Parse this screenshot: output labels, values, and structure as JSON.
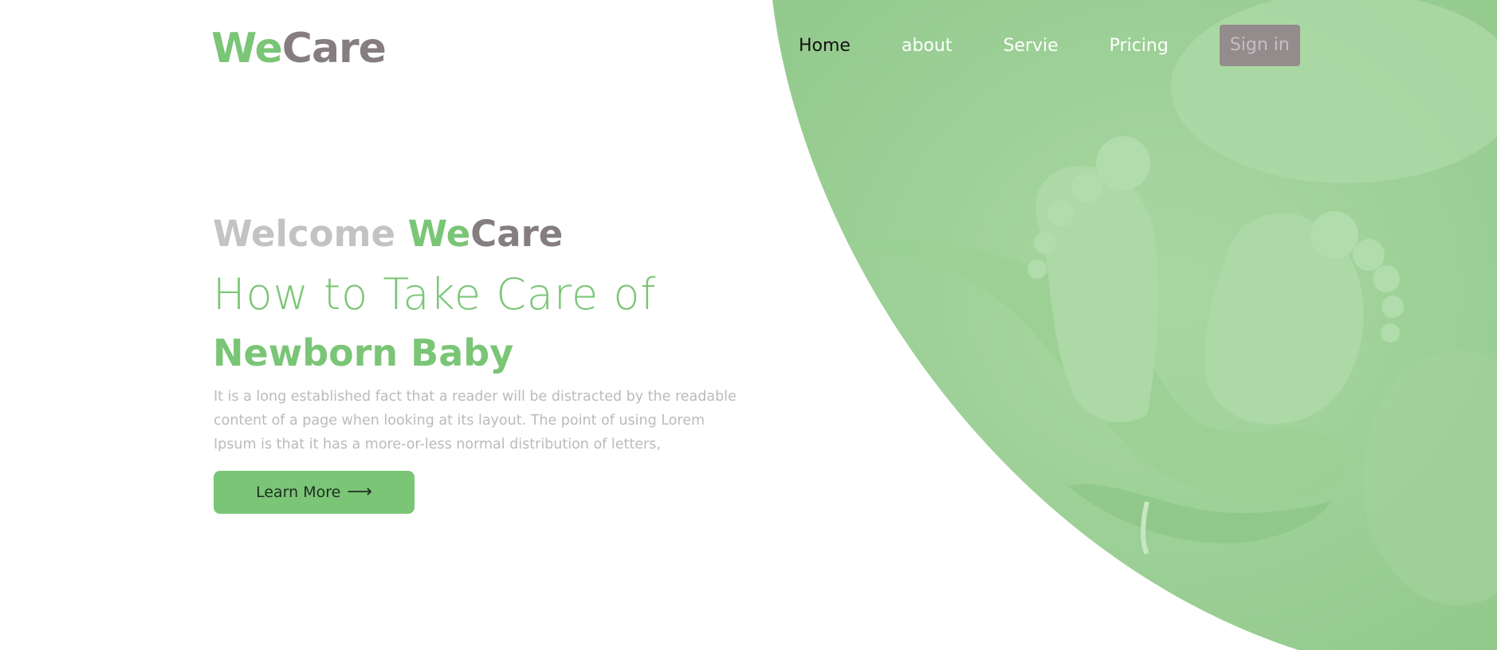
{
  "brand": {
    "logo_we": "We",
    "logo_care": "Care",
    "colors": {
      "green": "#7bc576",
      "gray": "#857d7e",
      "light_gray": "#c4c2c3",
      "hero_tint": "#9dd197"
    }
  },
  "nav": {
    "items": [
      {
        "label": "Home",
        "active": true
      },
      {
        "label": "about",
        "active": false
      },
      {
        "label": "Servie",
        "active": false
      },
      {
        "label": "Pricing",
        "active": false
      }
    ],
    "signin_label": "Sign in"
  },
  "hero": {
    "welcome_prefix": "Welcome",
    "welcome_we": "We",
    "welcome_care": "Care",
    "headline": "How to Take Care of",
    "subhead": "Newborn Baby",
    "description": "It is a long established fact that a reader will be distracted by the readable content of a page when looking at its layout. The point of using Lorem Ipsum is that it has a more-or-less normal distribution of letters,",
    "cta_label": "Learn More",
    "cta_icon": "arrow-right-icon",
    "image_subject": "baby-feet-in-hands-photo"
  }
}
